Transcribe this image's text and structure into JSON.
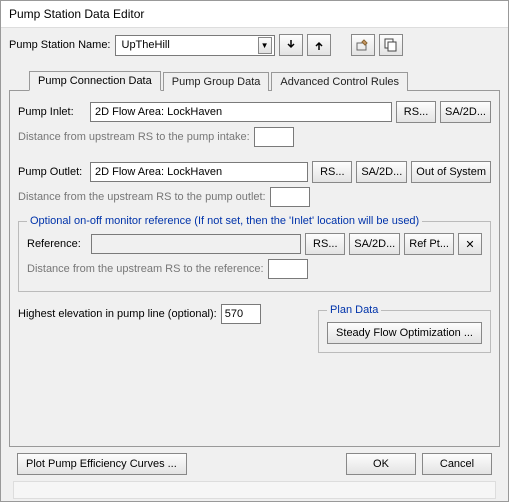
{
  "window": {
    "title": "Pump Station Data Editor"
  },
  "header": {
    "name_label": "Pump Station Name:",
    "name_value": "UpTheHill"
  },
  "tabs": {
    "t0": "Pump Connection Data",
    "t1": "Pump Group Data",
    "t2": "Advanced Control Rules"
  },
  "inlet": {
    "label": "Pump Inlet:",
    "value": "2D Flow Area: LockHaven",
    "rs": "RS...",
    "sa2d": "SA/2D...",
    "hint": "Distance from upstream RS to the pump intake:",
    "dist": ""
  },
  "outlet": {
    "label": "Pump Outlet:",
    "value": "2D Flow Area: LockHaven",
    "rs": "RS...",
    "sa2d": "SA/2D...",
    "out": "Out of System",
    "hint": "Distance from the upstream RS to the pump outlet:",
    "dist": ""
  },
  "monitor": {
    "legend": "Optional on-off monitor reference (If not set, then the 'Inlet' location will be used)",
    "ref_label": "Reference:",
    "ref_value": "",
    "rs": "RS...",
    "sa2d": "SA/2D...",
    "refpt": "Ref Pt...",
    "clear": "✕",
    "hint": "Distance from the upstream RS to the reference:",
    "dist": ""
  },
  "elev": {
    "label": "Highest elevation in pump line (optional):",
    "value": "570"
  },
  "plan": {
    "legend": "Plan Data",
    "steady": "Steady Flow Optimization ..."
  },
  "footer": {
    "plot": "Plot Pump Efficiency Curves ...",
    "ok": "OK",
    "cancel": "Cancel"
  }
}
